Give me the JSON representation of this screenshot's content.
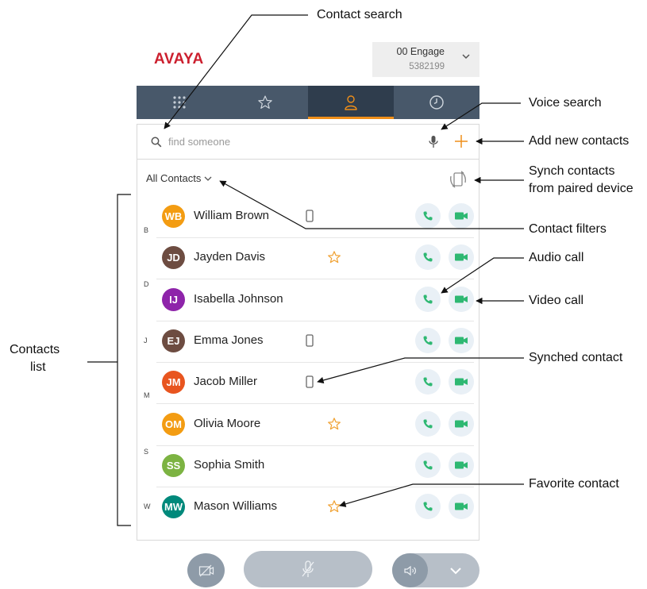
{
  "brand": {
    "logo_text": "AVAYA",
    "accent_color": "#cc1f2e"
  },
  "account": {
    "name": "00 Engage",
    "extension": "5382199"
  },
  "tabs": [
    {
      "name": "dialpad",
      "icon": "dialpad-icon",
      "active": false
    },
    {
      "name": "favorites",
      "icon": "star-icon",
      "active": false
    },
    {
      "name": "contacts",
      "icon": "person-icon",
      "active": true
    },
    {
      "name": "history",
      "icon": "clock-icon",
      "active": false
    }
  ],
  "search": {
    "placeholder": "find someone",
    "value": ""
  },
  "filter": {
    "label": "All Contacts"
  },
  "letters": [
    "B",
    "D",
    "J",
    "M",
    "S",
    "W"
  ],
  "contacts": [
    {
      "initials": "WB",
      "name": "William Brown",
      "color": "#f39c12",
      "marker": "synched"
    },
    {
      "initials": "JD",
      "name": "Jayden Davis",
      "color": "#6d4c41",
      "marker": "favorite"
    },
    {
      "initials": "IJ",
      "name": "Isabella Johnson",
      "color": "#8e24aa",
      "marker": ""
    },
    {
      "initials": "EJ",
      "name": "Emma Jones",
      "color": "#6d4c41",
      "marker": "synched"
    },
    {
      "initials": "JM",
      "name": "Jacob Miller",
      "color": "#e8551f",
      "marker": "synched"
    },
    {
      "initials": "OM",
      "name": "Olivia Moore",
      "color": "#f39c12",
      "marker": "favorite"
    },
    {
      "initials": "SS",
      "name": "Sophia Smith",
      "color": "#7cb342",
      "marker": ""
    },
    {
      "initials": "MW",
      "name": "Mason Williams",
      "color": "#00897b",
      "marker": "favorite"
    }
  ],
  "callouts": {
    "contact_search": "Contact search",
    "voice_search": "Voice search",
    "add_new_contacts": "Add new contacts",
    "synch_line1": "Synch contacts",
    "synch_line2": "from paired device",
    "contact_filters": "Contact filters",
    "audio_call": "Audio call",
    "video_call": "Video call",
    "synched_contact": "Synched contact",
    "favorite_contact": "Favorite contact",
    "contacts_list_line1": "Contacts",
    "contacts_list_line2": "list"
  },
  "colors": {
    "tabbar": "#48586a",
    "tab_active": "#2f3d4d",
    "tab_indicator": "#ef8f1a",
    "call_green": "#2eb872",
    "favorite_orange": "#f0a030"
  }
}
